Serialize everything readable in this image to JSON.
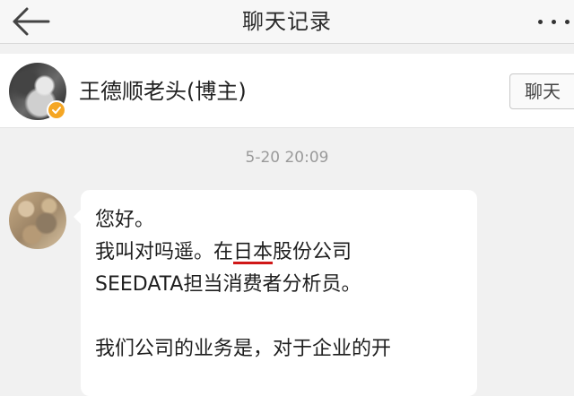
{
  "navbar": {
    "title": "聊天记录",
    "back_icon": "back-arrow-icon",
    "more_icon": "more-dots-icon"
  },
  "contact": {
    "name": "王德顺老头(博主)",
    "chat_button_label": "聊天",
    "verified_badge_color": "#f5a623",
    "avatar": "avatar-photo"
  },
  "conversation": {
    "timestamp": "5-20 20:09",
    "message": {
      "line1": "您好。",
      "line2_prefix": "我叫对吗遥。在",
      "line2_underlined": "日本",
      "line2_suffix": "股份公司",
      "line3": "SEEDATA担当消费者分析员。",
      "line5": "我们公司的业务是，对于企业的开"
    }
  },
  "colors": {
    "background": "#f1f1f1",
    "underline": "#d01818"
  }
}
